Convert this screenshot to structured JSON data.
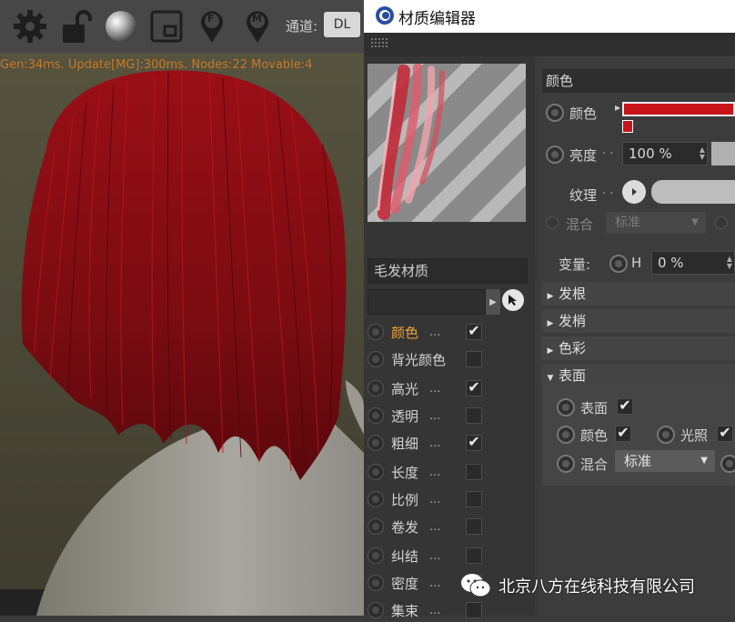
{
  "viewport": {
    "toolbar": {
      "icons": [
        "gear-icon",
        "unlock-icon",
        "sphere-icon",
        "frame-icon",
        "pin-f-icon",
        "pin-m-icon"
      ],
      "pin_f_letter": "F",
      "pin_m_letter": "M",
      "channel_label": "通道:",
      "channel_value": "DL"
    },
    "status_text": "Gen:34ms. Update[MG]:300ms. Nodes:22 Movable:4"
  },
  "editor": {
    "title": "材质编辑器",
    "material_name": "毛发材质",
    "channels": [
      {
        "label": "颜色",
        "dots": "...",
        "checked": true,
        "active": true
      },
      {
        "label": "背光颜色",
        "dots": "",
        "checked": false,
        "active": false
      },
      {
        "label": "高光",
        "dots": "...",
        "checked": true,
        "active": false
      },
      {
        "label": "透明",
        "dots": "...",
        "checked": false,
        "active": false
      },
      {
        "label": "粗细",
        "dots": "...",
        "checked": true,
        "active": false
      },
      {
        "label": "长度",
        "dots": "...",
        "checked": false,
        "active": false
      },
      {
        "label": "比例",
        "dots": "...",
        "checked": false,
        "active": false
      },
      {
        "label": "卷发",
        "dots": "...",
        "checked": false,
        "active": false
      },
      {
        "label": "纠结",
        "dots": "...",
        "checked": false,
        "active": false
      },
      {
        "label": "密度",
        "dots": "...",
        "checked": false,
        "active": false
      },
      {
        "label": "集束",
        "dots": "...",
        "checked": false,
        "active": false
      }
    ],
    "props": {
      "section_title": "颜色",
      "color_label": "颜色",
      "color_value": "#c8141b",
      "brightness_label": "亮度",
      "brightness_value": "100 %",
      "texture_label": "纹理",
      "mix_label": "混合",
      "mix_value": "标准",
      "variation_label": "变量:",
      "variation_h": "H",
      "variation_value": "0 %",
      "dots": ". ."
    },
    "groups": [
      {
        "label": "发根",
        "expanded": false
      },
      {
        "label": "发梢",
        "expanded": false
      },
      {
        "label": "色彩",
        "expanded": false
      },
      {
        "label": "表面",
        "expanded": true
      }
    ],
    "surface": {
      "surface_label": "表面",
      "color_label": "颜色",
      "lighting_label": "光照",
      "mix_label": "混合",
      "mix_value": "标准"
    }
  },
  "watermark": {
    "text": "北京八方在线科技有限公司"
  }
}
